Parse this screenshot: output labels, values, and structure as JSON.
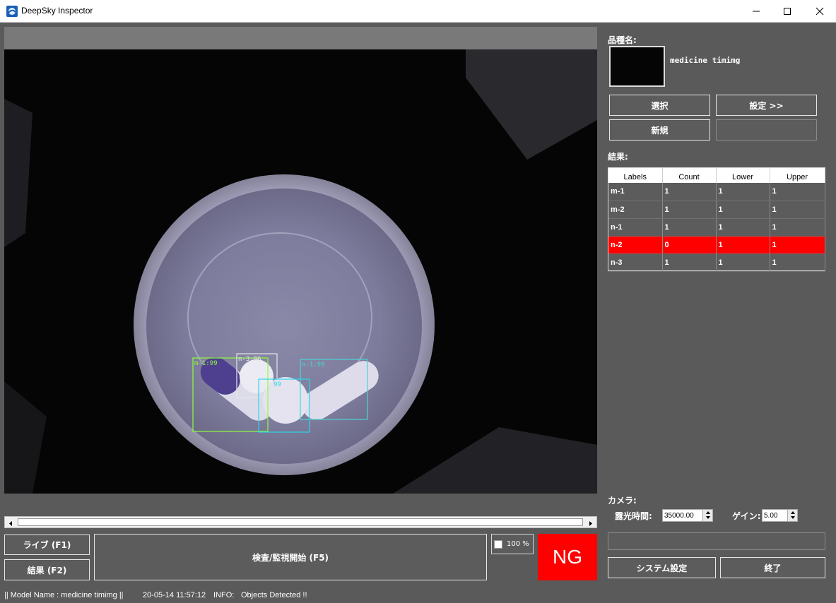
{
  "window": {
    "title": "DeepSky Inspector",
    "icons": {
      "app": "app-logo-icon",
      "minimize": "minimize-icon",
      "maximize": "maximize-icon",
      "close": "close-icon"
    }
  },
  "viewer": {
    "detections": [
      {
        "label": "m-1:99",
        "color": "#8cff3c"
      },
      {
        "label": "n-3:86",
        "color": "#e6e6e6"
      },
      {
        "label": "n-1:99",
        "color": "#49d6d6"
      },
      {
        "label": "99",
        "color": "#2bd7ea"
      }
    ]
  },
  "buttons": {
    "live": "ライブ (F1)",
    "result": "結果 (F2)",
    "inspect": "検査/監視開始 (F5)",
    "select": "選択",
    "settings": "設定 >>",
    "new": "新規",
    "system_settings": "システム設定",
    "exit": "終了"
  },
  "zoom": {
    "label": "100 %",
    "checked": false
  },
  "judgement": {
    "text": "NG",
    "color": "#ff0000"
  },
  "product": {
    "label": "品種名:",
    "name": "medicine timimg"
  },
  "results": {
    "label": "結果:",
    "columns": [
      "Labels",
      "Count",
      "Lower",
      "Upper"
    ],
    "rows": [
      {
        "label": "m-1",
        "count": "1",
        "lower": "1",
        "upper": "1",
        "ng": false
      },
      {
        "label": "m-2",
        "count": "1",
        "lower": "1",
        "upper": "1",
        "ng": false
      },
      {
        "label": "n-1",
        "count": "1",
        "lower": "1",
        "upper": "1",
        "ng": false
      },
      {
        "label": "n-2",
        "count": "0",
        "lower": "1",
        "upper": "1",
        "ng": true
      },
      {
        "label": "n-3",
        "count": "1",
        "lower": "1",
        "upper": "1",
        "ng": false
      }
    ]
  },
  "camera": {
    "label": "カメラ:",
    "exposure_label": "露光時間:",
    "exposure_value": "35000.00",
    "gain_label": "ゲイン:",
    "gain_value": "5.00"
  },
  "status": {
    "model": "|| Model Name : medicine timimg ||",
    "timestamp": "20-05-14 11:57:12",
    "info_label": "INFO:",
    "info_message": "Objects Detected !!"
  }
}
